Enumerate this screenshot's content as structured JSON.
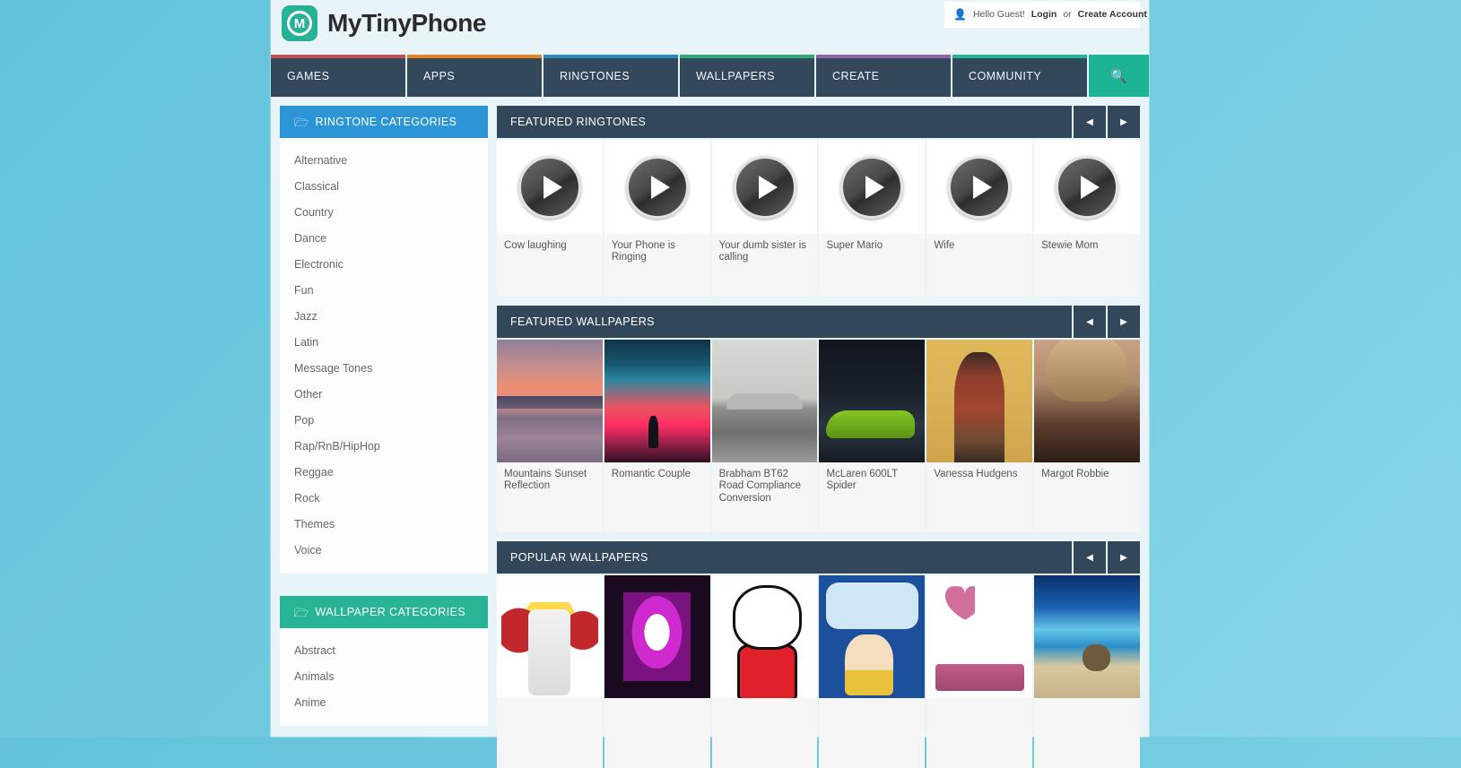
{
  "site": {
    "brand_name": "MyTinyPhone",
    "logo_letter": "M"
  },
  "account": {
    "greeting": "Hello Guest!",
    "login_label": "Login",
    "separator": "or",
    "create_label": "Create Account",
    "user_icon": "user-icon"
  },
  "nav": {
    "items": [
      {
        "label": "GAMES",
        "color": "#c0504d"
      },
      {
        "label": "APPS",
        "color": "#e8821e"
      },
      {
        "label": "RINGTONES",
        "color": "#2a87b8"
      },
      {
        "label": "WALLPAPERS",
        "color": "#2eab74"
      },
      {
        "label": "CREATE",
        "color": "#9163ab"
      },
      {
        "label": "COMMUNITY",
        "color": "#21b597"
      }
    ],
    "search_icon": "search-icon",
    "search_bg": "#1cb493"
  },
  "sidebar": {
    "ringtone_panel": {
      "title": "RINGTONE CATEGORIES",
      "icon": "folder-open-icon",
      "color": "#2b95d6",
      "items": [
        "Alternative",
        "Classical",
        "Country",
        "Dance",
        "Electronic",
        "Fun",
        "Jazz",
        "Latin",
        "Message Tones",
        "Other",
        "Pop",
        "Rap/RnB/HipHop",
        "Reggae",
        "Rock",
        "Themes",
        "Voice"
      ]
    },
    "wallpaper_panel": {
      "title": "WALLPAPER CATEGORIES",
      "icon": "folder-open-icon",
      "color": "#28b595",
      "items": [
        "Abstract",
        "Animals",
        "Anime"
      ]
    }
  },
  "sections": [
    {
      "title": "FEATURED RINGTONES",
      "prev_icon": "chevron-left-icon",
      "next_icon": "chevron-right-icon",
      "items": [
        {
          "title": "Cow laughing"
        },
        {
          "title": "Your Phone is Ringing"
        },
        {
          "title": "Your dumb sister is calling"
        },
        {
          "title": "Super Mario"
        },
        {
          "title": "Wife"
        },
        {
          "title": "Stewie Mom"
        }
      ]
    },
    {
      "title": "FEATURED WALLPAPERS",
      "prev_icon": "chevron-left-icon",
      "next_icon": "chevron-right-icon",
      "items": [
        {
          "title": "Mountains Sunset Reflection",
          "art": "t-mountain"
        },
        {
          "title": "Romantic Couple",
          "art": "t-romantic"
        },
        {
          "title": "Brabham BT62 Road Compliance Conversion",
          "art": "t-brabham"
        },
        {
          "title": "McLaren 600LT Spider",
          "art": "t-mclaren"
        },
        {
          "title": "Vanessa Hudgens",
          "art": "t-vanessa"
        },
        {
          "title": "Margot Robbie",
          "art": "t-margot"
        }
      ]
    },
    {
      "title": "POPULAR WALLPAPERS",
      "prev_icon": "chevron-left-icon",
      "next_icon": "chevron-right-icon",
      "items": [
        {
          "title": "",
          "art": "t-athf"
        },
        {
          "title": "",
          "art": "t-playboy"
        },
        {
          "title": "",
          "art": "t-kitty"
        },
        {
          "title": "",
          "art": "t-stewie"
        },
        {
          "title": "",
          "art": "t-heart"
        },
        {
          "title": "",
          "art": "t-beach"
        }
      ]
    }
  ]
}
